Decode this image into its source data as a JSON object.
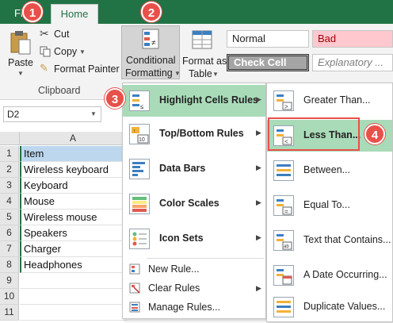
{
  "ribbon": {
    "tab_file": "Fil",
    "tab_home": "Home",
    "paste": "Paste",
    "cut": "Cut",
    "copy": "Copy",
    "format_painter": "Format Painter",
    "clipboard": "Clipboard",
    "cf_line1": "Conditional",
    "cf_line2": "Formatting",
    "fat_line1": "Format as",
    "fat_line2": "Table",
    "styles": [
      "Normal",
      "Bad",
      "Check Cell",
      "Explanatory ..."
    ],
    "style_colors": {
      "bad_bg": "#ffc7ce",
      "bad_fg": "#9c0006",
      "check_bg": "#a5a5a5"
    }
  },
  "namebox": "D2",
  "grid": {
    "column": "A",
    "rows": [
      {
        "num": "1",
        "value": "Item"
      },
      {
        "num": "2",
        "value": "Wireless keyboard"
      },
      {
        "num": "3",
        "value": "Keyboard"
      },
      {
        "num": "4",
        "value": "Mouse"
      },
      {
        "num": "5",
        "value": "Wireless mouse"
      },
      {
        "num": "6",
        "value": "Speakers"
      },
      {
        "num": "7",
        "value": "Charger"
      },
      {
        "num": "8",
        "value": "Headphones"
      },
      {
        "num": "9",
        "value": ""
      },
      {
        "num": "10",
        "value": ""
      },
      {
        "num": "11",
        "value": ""
      }
    ]
  },
  "cf_menu": {
    "highlight": "Highlight Cells Rules",
    "topbottom": "Top/Bottom Rules",
    "databars": "Data Bars",
    "colorscales": "Color Scales",
    "iconsets": "Icon Sets",
    "newrule": "New Rule...",
    "clearrules": "Clear Rules",
    "managerules": "Manage Rules..."
  },
  "sub_menu": {
    "greater": "Greater Than...",
    "less": "Less Than...",
    "between": "Between...",
    "equal": "Equal To...",
    "text": "Text that Contains...",
    "date": "A Date Occurring...",
    "duplicate": "Duplicate Values..."
  },
  "badges": [
    "1",
    "2",
    "3",
    "4"
  ],
  "colors": {
    "accent": "#217346",
    "highlight": "#a9dbb8",
    "badge": "#e8504a"
  }
}
